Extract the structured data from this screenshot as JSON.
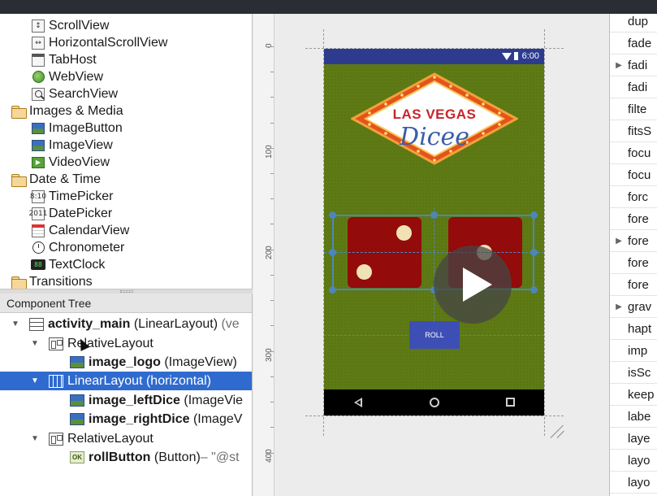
{
  "palette": {
    "items": [
      {
        "label": "ScrollView",
        "icon": "scrollview-icon",
        "folder": false
      },
      {
        "label": "HorizontalScrollView",
        "icon": "horizontal-scrollview-icon",
        "folder": false
      },
      {
        "label": "TabHost",
        "icon": "tabhost-icon",
        "folder": false
      },
      {
        "label": "WebView",
        "icon": "webview-globe-icon",
        "folder": false
      },
      {
        "label": "SearchView",
        "icon": "searchview-icon",
        "folder": false
      },
      {
        "label": "Images & Media",
        "icon": "folder-icon",
        "folder": true
      },
      {
        "label": "ImageButton",
        "icon": "imagebutton-icon",
        "folder": false
      },
      {
        "label": "ImageView",
        "icon": "imageview-icon",
        "folder": false
      },
      {
        "label": "VideoView",
        "icon": "videoview-icon",
        "folder": false
      },
      {
        "label": "Date & Time",
        "icon": "folder-icon",
        "folder": true
      },
      {
        "label": "TimePicker",
        "icon": "timepicker-icon",
        "folder": false
      },
      {
        "label": "DatePicker",
        "icon": "datepicker-icon",
        "folder": false
      },
      {
        "label": "CalendarView",
        "icon": "calendarview-icon",
        "folder": false
      },
      {
        "label": "Chronometer",
        "icon": "chronometer-icon",
        "folder": false
      },
      {
        "label": "TextClock",
        "icon": "textclock-icon",
        "folder": false
      },
      {
        "label": "Transitions",
        "icon": "folder-icon",
        "folder": true
      }
    ]
  },
  "component_tree": {
    "title": "Component Tree",
    "rows": [
      {
        "name": "activity_main",
        "type": "(LinearLayout)",
        "extra": "(ve"
      },
      {
        "name": "RelativeLayout",
        "type": "",
        "extra": ""
      },
      {
        "name": "image_logo",
        "type": "(ImageView)",
        "extra": ""
      },
      {
        "name": "LinearLayout (horizontal)",
        "type": "",
        "extra": ""
      },
      {
        "name": "image_leftDice",
        "type": "(ImageVie",
        "extra": ""
      },
      {
        "name": "image_rightDice",
        "type": "(ImageV",
        "extra": ""
      },
      {
        "name": "RelativeLayout",
        "type": "",
        "extra": ""
      },
      {
        "name": "rollButton",
        "type": "(Button)",
        "extra": " – \"@st"
      }
    ]
  },
  "ruler": {
    "labels": [
      "0",
      "100",
      "200",
      "300",
      "400"
    ]
  },
  "device": {
    "status_time": "6:00",
    "logo_line1": "LAS VEGAS",
    "logo_line2": "Dicee",
    "roll_label": "ROLL",
    "left_die_pips": 2,
    "right_die_pips": 2
  },
  "attributes": {
    "rows": [
      {
        "label": "dup",
        "expandable": false
      },
      {
        "label": "fade",
        "expandable": false
      },
      {
        "label": "fadi",
        "expandable": true
      },
      {
        "label": "fadi",
        "expandable": false
      },
      {
        "label": "filte",
        "expandable": false
      },
      {
        "label": "fitsS",
        "expandable": false
      },
      {
        "label": "focu",
        "expandable": false
      },
      {
        "label": "focu",
        "expandable": false
      },
      {
        "label": "forc",
        "expandable": false
      },
      {
        "label": "fore",
        "expandable": false
      },
      {
        "label": "fore",
        "expandable": true
      },
      {
        "label": "fore",
        "expandable": false
      },
      {
        "label": "fore",
        "expandable": false
      },
      {
        "label": "grav",
        "expandable": true
      },
      {
        "label": "hapt",
        "expandable": false
      },
      {
        "label": "imp",
        "expandable": false
      },
      {
        "label": "isSc",
        "expandable": false
      },
      {
        "label": "keep",
        "expandable": false
      },
      {
        "label": "labe",
        "expandable": false
      },
      {
        "label": "laye",
        "expandable": false
      },
      {
        "label": "layo",
        "expandable": false
      },
      {
        "label": "layo",
        "expandable": false
      }
    ]
  },
  "colors": {
    "selection": "#2f6bcf",
    "device_bg": "#5e7a14",
    "status_bar": "#2d3b8f",
    "die": "#930b0b",
    "roll_button": "#3d4fb5"
  }
}
